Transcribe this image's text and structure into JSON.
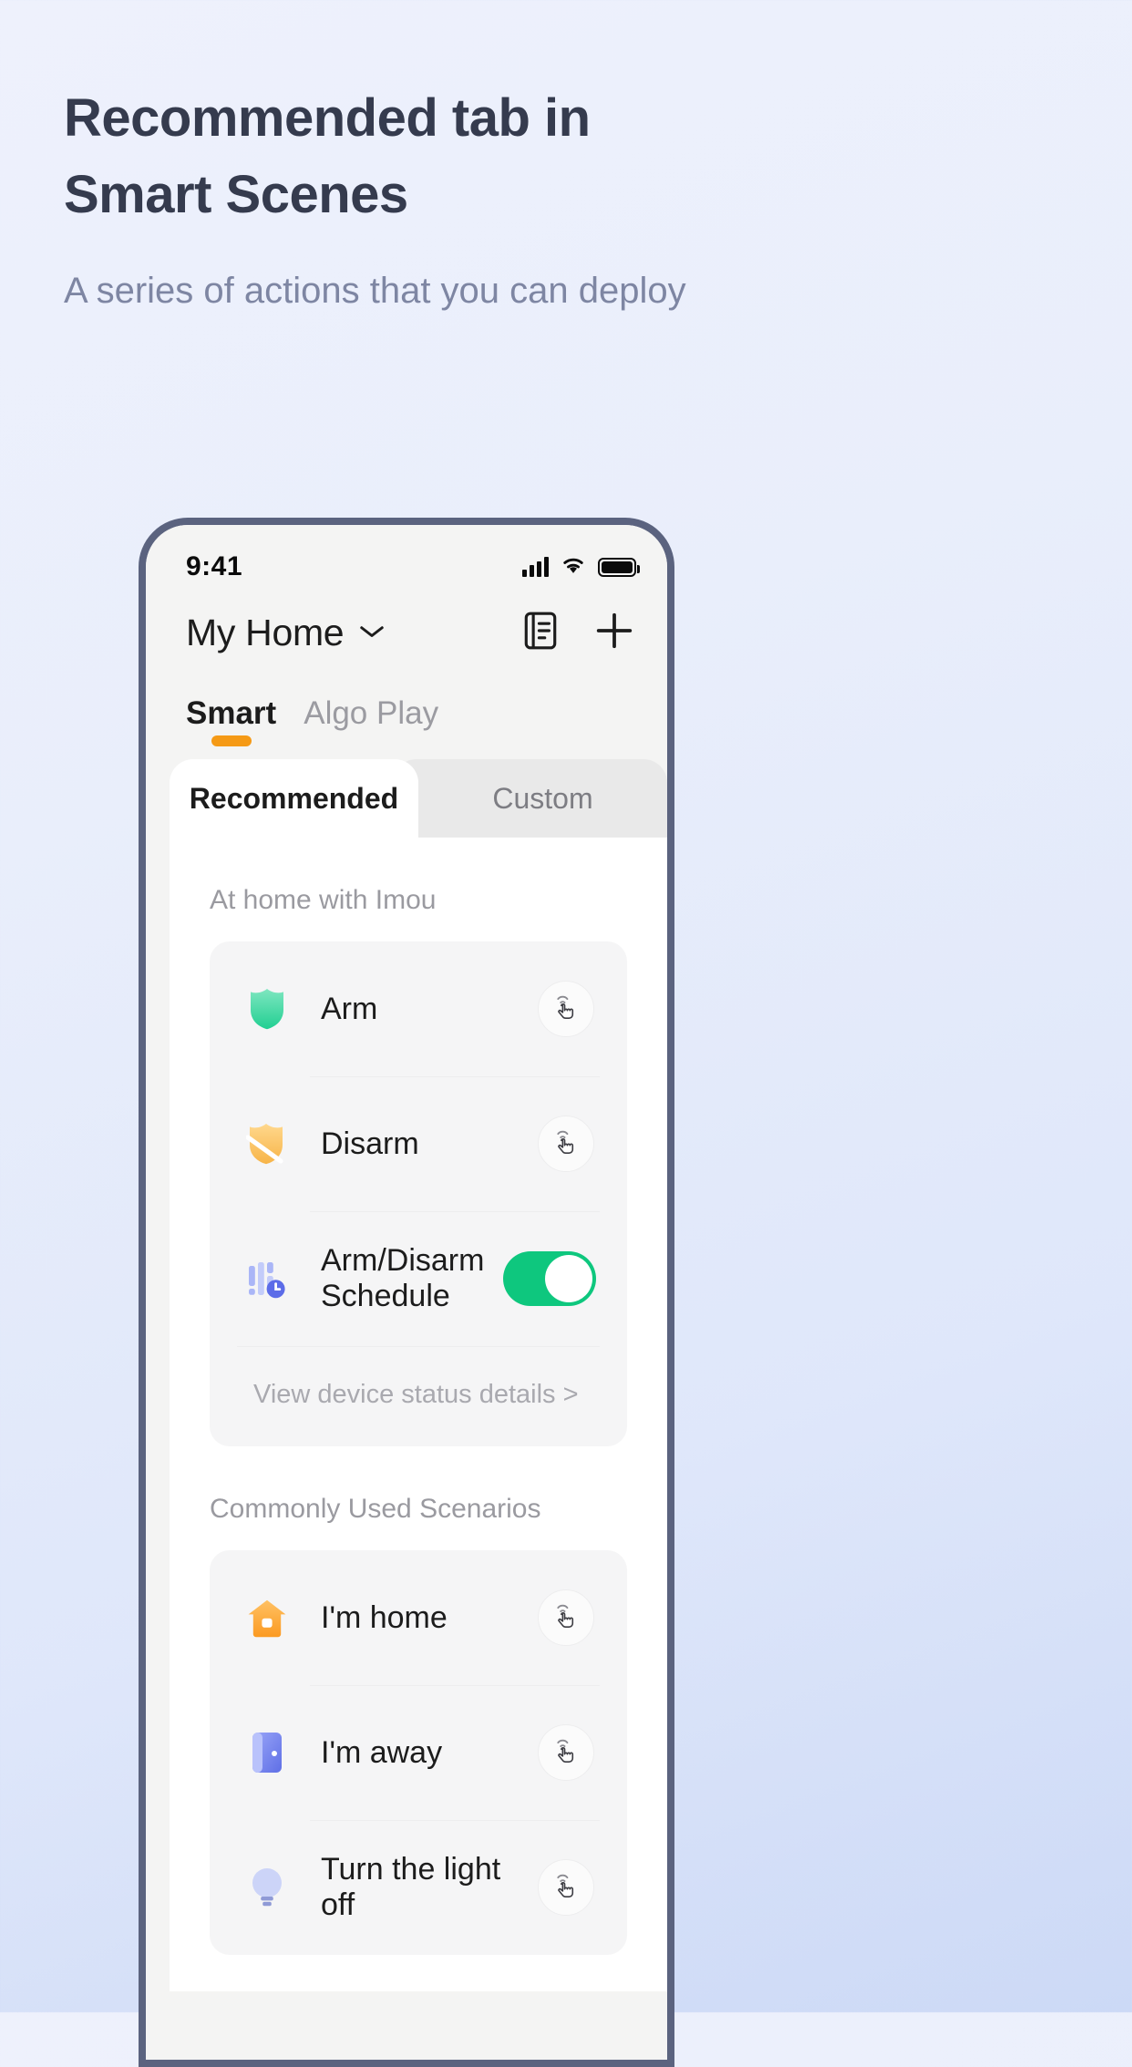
{
  "promo": {
    "headline": "Recommended tab in Smart Scenes",
    "headline_line1": "Recommended tab in",
    "headline_line2": "Smart Scenes",
    "subtitle": "A series of actions that you can deploy",
    "heading_color": "#353b4e",
    "subtitle_color": "#7e86a3"
  },
  "phone": {
    "status_bar": {
      "time": "9:41",
      "signal_icon": "cellular-signal-icon",
      "wifi_icon": "wifi-icon",
      "battery_icon": "battery-full-icon"
    },
    "header": {
      "home_name": "My Home",
      "chevron_icon": "chevron-down-icon",
      "log_icon": "note-list-icon",
      "add_icon": "plus-icon"
    },
    "main_tabs": [
      {
        "label": "Smart",
        "active": true
      },
      {
        "label": "Algo Play",
        "active": false
      }
    ],
    "accent_color": "#f59a16",
    "card_tabs": [
      {
        "label": "Recommended",
        "active": true
      },
      {
        "label": "Custom",
        "active": false
      }
    ],
    "sections": [
      {
        "title": "At home with Imou",
        "rows": [
          {
            "label": "Arm",
            "icon": "shield-icon",
            "icon_color": "#34d69e",
            "control": "tap"
          },
          {
            "label": "Disarm",
            "icon": "shield-slash-icon",
            "icon_color": "#fcc265",
            "control": "tap"
          },
          {
            "label": "Arm/Disarm Schedule",
            "icon": "schedule-clock-icon",
            "icon_color": "#9aa8f5",
            "control": "toggle",
            "toggle_on": true
          }
        ],
        "footer": "View device status details >"
      },
      {
        "title": "Commonly Used Scenarios",
        "rows": [
          {
            "label": "I'm home",
            "icon": "house-icon",
            "icon_color": "#ffab2e",
            "control": "tap"
          },
          {
            "label": "I'm away",
            "icon": "door-icon",
            "icon_color": "#6e7ff0",
            "control": "tap"
          },
          {
            "label": "Turn the light off",
            "icon": "bulb-icon",
            "icon_color": "#c9d0f7",
            "control": "tap"
          }
        ],
        "footer": ""
      }
    ],
    "toggle_on_color": "#0ec77e",
    "tap_icon": "hand-tap-icon"
  }
}
